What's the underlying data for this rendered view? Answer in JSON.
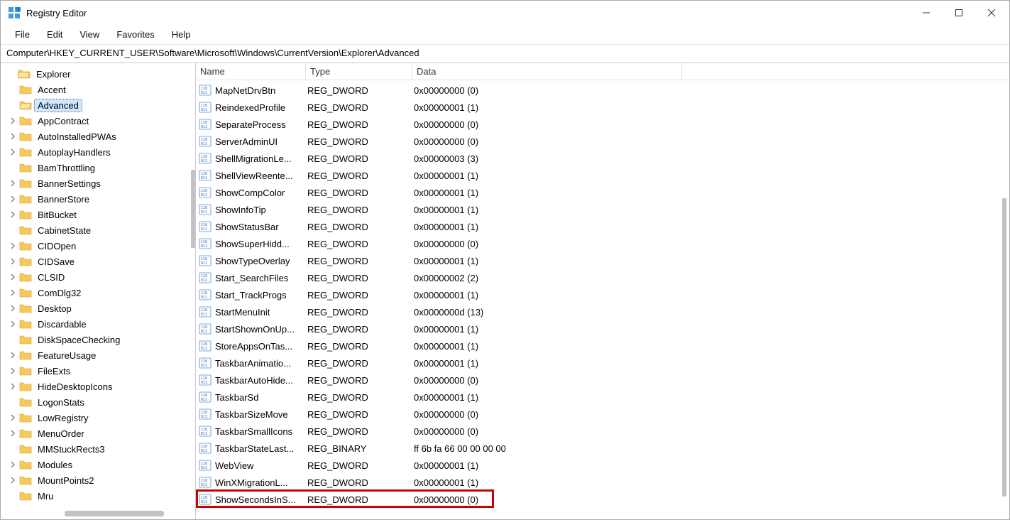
{
  "window": {
    "title": "Registry Editor"
  },
  "menu": {
    "items": [
      "File",
      "Edit",
      "View",
      "Favorites",
      "Help"
    ]
  },
  "address": "Computer\\HKEY_CURRENT_USER\\Software\\Microsoft\\Windows\\CurrentVersion\\Explorer\\Advanced",
  "tree": {
    "root": "Explorer",
    "items": [
      {
        "label": "Accent",
        "expandable": false
      },
      {
        "label": "Advanced",
        "expandable": false,
        "selected": true
      },
      {
        "label": "AppContract",
        "expandable": true
      },
      {
        "label": "AutoInstalledPWAs",
        "expandable": true
      },
      {
        "label": "AutoplayHandlers",
        "expandable": true
      },
      {
        "label": "BamThrottling",
        "expandable": false
      },
      {
        "label": "BannerSettings",
        "expandable": true
      },
      {
        "label": "BannerStore",
        "expandable": true
      },
      {
        "label": "BitBucket",
        "expandable": true
      },
      {
        "label": "CabinetState",
        "expandable": false
      },
      {
        "label": "CIDOpen",
        "expandable": true
      },
      {
        "label": "CIDSave",
        "expandable": true
      },
      {
        "label": "CLSID",
        "expandable": true
      },
      {
        "label": "ComDlg32",
        "expandable": true
      },
      {
        "label": "Desktop",
        "expandable": true
      },
      {
        "label": "Discardable",
        "expandable": true
      },
      {
        "label": "DiskSpaceChecking",
        "expandable": false
      },
      {
        "label": "FeatureUsage",
        "expandable": true
      },
      {
        "label": "FileExts",
        "expandable": true
      },
      {
        "label": "HideDesktopIcons",
        "expandable": true
      },
      {
        "label": "LogonStats",
        "expandable": false
      },
      {
        "label": "LowRegistry",
        "expandable": true
      },
      {
        "label": "MenuOrder",
        "expandable": true
      },
      {
        "label": "MMStuckRects3",
        "expandable": false
      },
      {
        "label": "Modules",
        "expandable": true
      },
      {
        "label": "MountPoints2",
        "expandable": true
      },
      {
        "label": "Mru",
        "expandable": false
      }
    ]
  },
  "list": {
    "headers": {
      "name": "Name",
      "type": "Type",
      "data": "Data"
    },
    "rows": [
      {
        "name": "MapNetDrvBtn",
        "type": "REG_DWORD",
        "data": "0x00000000 (0)"
      },
      {
        "name": "ReindexedProfile",
        "type": "REG_DWORD",
        "data": "0x00000001 (1)"
      },
      {
        "name": "SeparateProcess",
        "type": "REG_DWORD",
        "data": "0x00000000 (0)"
      },
      {
        "name": "ServerAdminUI",
        "type": "REG_DWORD",
        "data": "0x00000000 (0)"
      },
      {
        "name": "ShellMigrationLe...",
        "type": "REG_DWORD",
        "data": "0x00000003 (3)"
      },
      {
        "name": "ShellViewReente...",
        "type": "REG_DWORD",
        "data": "0x00000001 (1)"
      },
      {
        "name": "ShowCompColor",
        "type": "REG_DWORD",
        "data": "0x00000001 (1)"
      },
      {
        "name": "ShowInfoTip",
        "type": "REG_DWORD",
        "data": "0x00000001 (1)"
      },
      {
        "name": "ShowStatusBar",
        "type": "REG_DWORD",
        "data": "0x00000001 (1)"
      },
      {
        "name": "ShowSuperHidd...",
        "type": "REG_DWORD",
        "data": "0x00000000 (0)"
      },
      {
        "name": "ShowTypeOverlay",
        "type": "REG_DWORD",
        "data": "0x00000001 (1)"
      },
      {
        "name": "Start_SearchFiles",
        "type": "REG_DWORD",
        "data": "0x00000002 (2)"
      },
      {
        "name": "Start_TrackProgs",
        "type": "REG_DWORD",
        "data": "0x00000001 (1)"
      },
      {
        "name": "StartMenuInit",
        "type": "REG_DWORD",
        "data": "0x0000000d (13)"
      },
      {
        "name": "StartShownOnUp...",
        "type": "REG_DWORD",
        "data": "0x00000001 (1)"
      },
      {
        "name": "StoreAppsOnTas...",
        "type": "REG_DWORD",
        "data": "0x00000001 (1)"
      },
      {
        "name": "TaskbarAnimatio...",
        "type": "REG_DWORD",
        "data": "0x00000001 (1)"
      },
      {
        "name": "TaskbarAutoHide...",
        "type": "REG_DWORD",
        "data": "0x00000000 (0)"
      },
      {
        "name": "TaskbarSd",
        "type": "REG_DWORD",
        "data": "0x00000001 (1)"
      },
      {
        "name": "TaskbarSizeMove",
        "type": "REG_DWORD",
        "data": "0x00000000 (0)"
      },
      {
        "name": "TaskbarSmallIcons",
        "type": "REG_DWORD",
        "data": "0x00000000 (0)"
      },
      {
        "name": "TaskbarStateLast...",
        "type": "REG_BINARY",
        "data": "ff 6b fa 66 00 00 00 00"
      },
      {
        "name": "WebView",
        "type": "REG_DWORD",
        "data": "0x00000001 (1)"
      },
      {
        "name": "WinXMigrationL...",
        "type": "REG_DWORD",
        "data": "0x00000001 (1)"
      },
      {
        "name": "ShowSecondsInS...",
        "type": "REG_DWORD",
        "data": "0x00000000 (0)",
        "highlight": true
      }
    ]
  }
}
